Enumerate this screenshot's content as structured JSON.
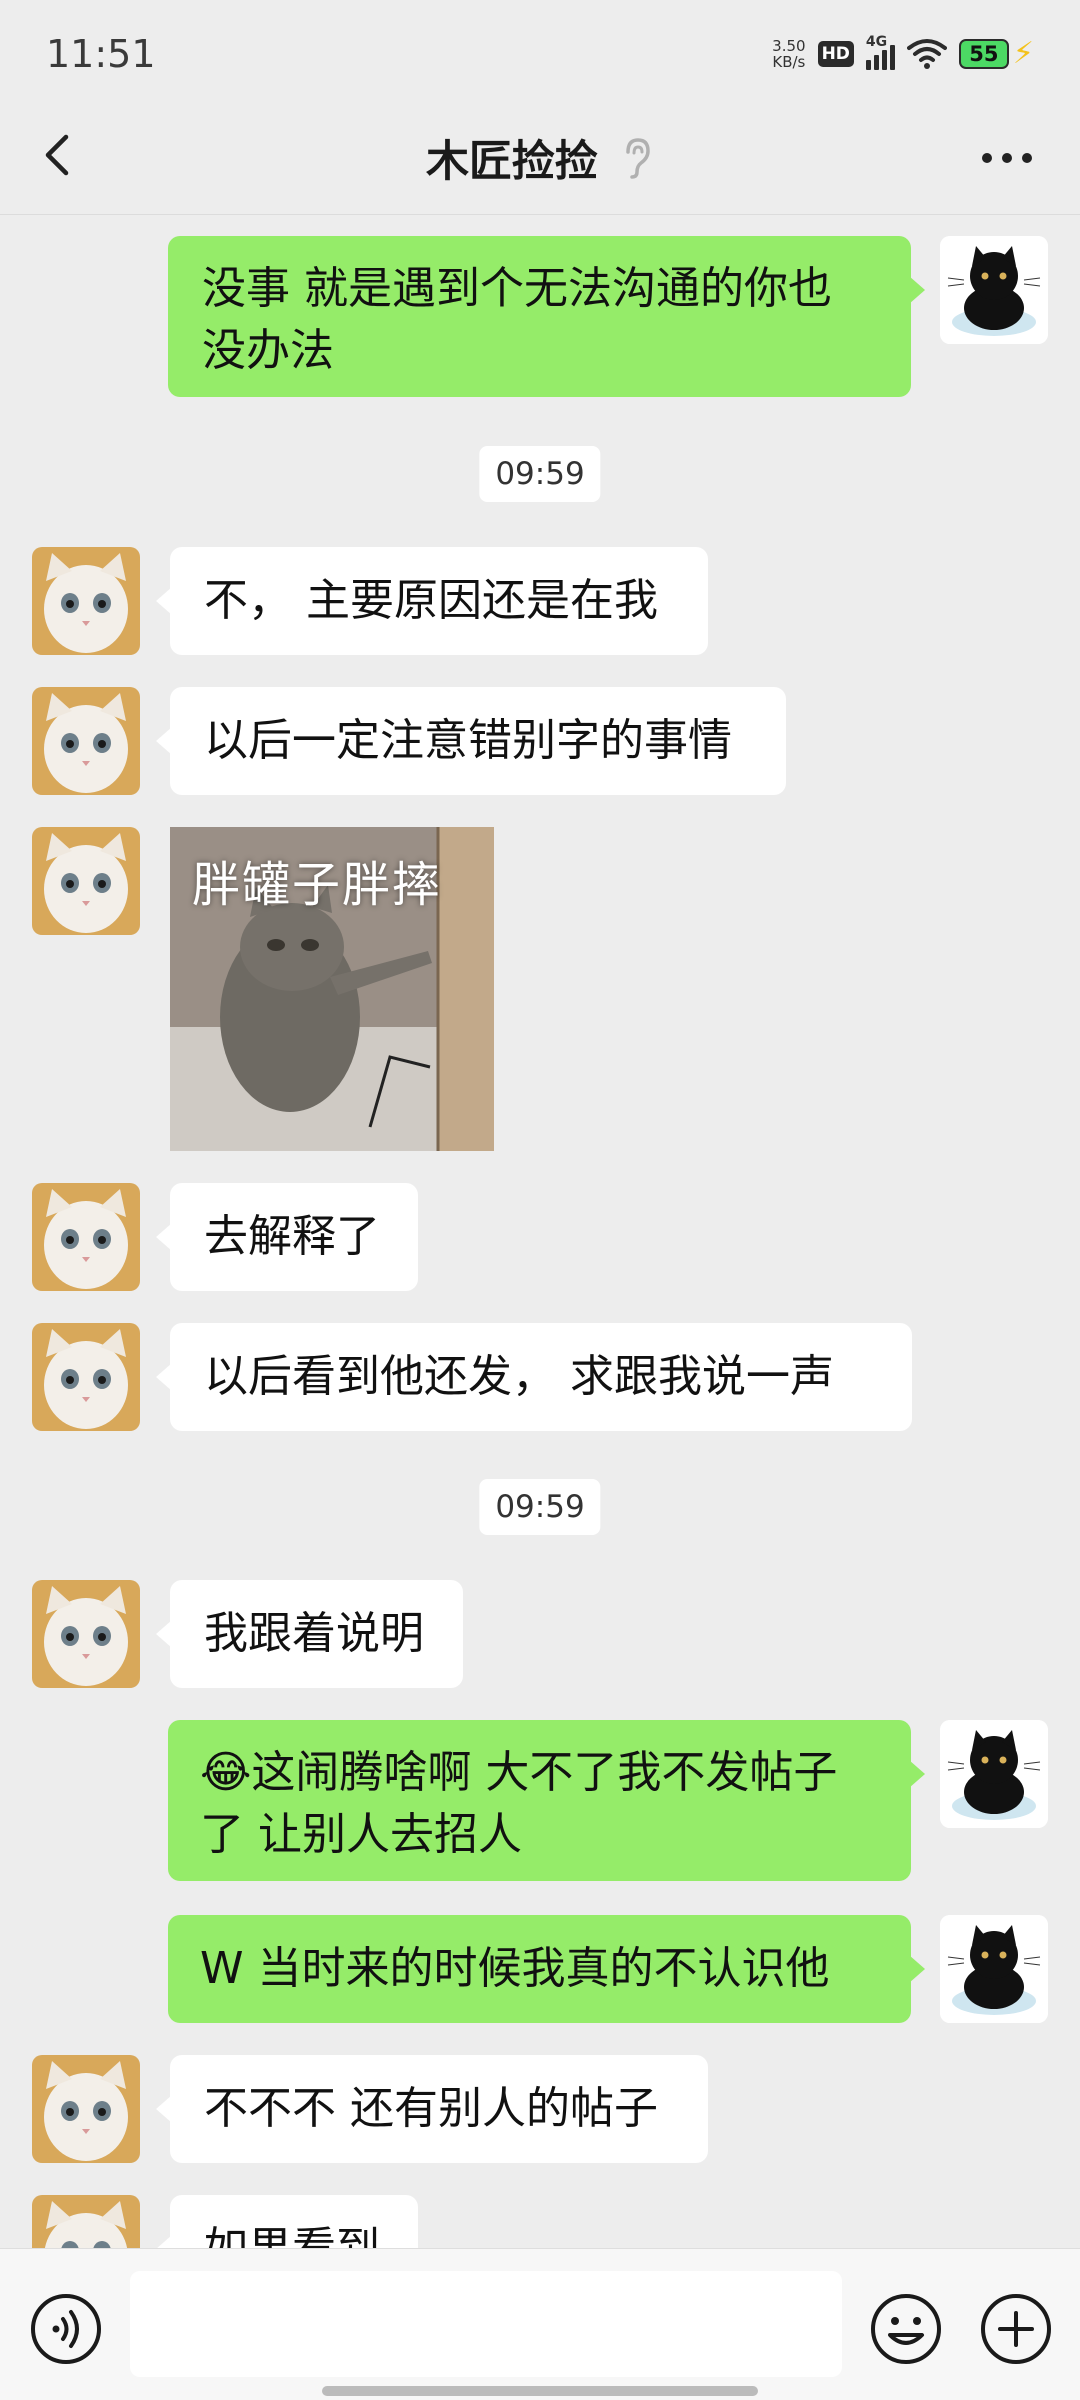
{
  "status_bar": {
    "time": "11:51",
    "net_speed_value": "3.50",
    "net_speed_unit": "KB/s",
    "hd_label": "HD",
    "network_type": "4G",
    "battery_level": "55"
  },
  "header": {
    "title": "木匠捡捡",
    "icons": [
      "back-arrow-icon",
      "earpiece-icon",
      "more-icon"
    ]
  },
  "messages": [
    {
      "side": "right",
      "type": "text",
      "text": "没事 就是遇到个无法沟通的你也没办法",
      "line1": "没事 就是遇到个无法沟通的你也",
      "line2": "没办法"
    },
    {
      "type": "time",
      "text": "09:59"
    },
    {
      "side": "left",
      "type": "text",
      "text": "不， 主要原因还是在我"
    },
    {
      "side": "left",
      "type": "text",
      "text": "以后一定注意错别字的事情"
    },
    {
      "side": "left",
      "type": "sticker",
      "caption": "胖罐子胖摔"
    },
    {
      "side": "left",
      "type": "text",
      "text": "去解释了"
    },
    {
      "side": "left",
      "type": "text",
      "text": "以后看到他还发， 求跟我说一声"
    },
    {
      "type": "time",
      "text": "09:59"
    },
    {
      "side": "left",
      "type": "text",
      "text": "我跟着说明"
    },
    {
      "side": "right",
      "type": "text",
      "emoji": "😂",
      "line1": "这闹腾啥啊 大不了我不发帖子",
      "line2": "了 让别人去招人"
    },
    {
      "side": "right",
      "type": "text",
      "text": "W 当时来的时候我真的不认识他"
    },
    {
      "side": "left",
      "type": "text",
      "text": "不不不 还有别人的帖子"
    },
    {
      "side": "left",
      "type": "text",
      "text": "如果看到"
    }
  ],
  "input_bar": {
    "placeholder": "",
    "icons": [
      "voice-icon",
      "emoji-icon",
      "plus-icon"
    ]
  },
  "colors": {
    "background": "#EDEDED",
    "my_bubble": "#95EC69",
    "their_bubble": "#FFFFFF",
    "battery": "#4CD964"
  }
}
